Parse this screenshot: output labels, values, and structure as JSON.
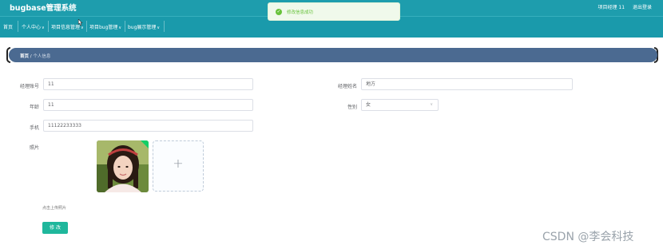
{
  "header": {
    "title": "bugbase管理系统",
    "user_label": "项目经理 11",
    "logout_label": "退出登录"
  },
  "nav": {
    "items": [
      {
        "label": "首页"
      },
      {
        "label": "个人中心"
      },
      {
        "label": "项目信息管理"
      },
      {
        "label": "项目bug管理"
      },
      {
        "label": "bug展示管理"
      }
    ]
  },
  "toast": {
    "message": "修改信息成功"
  },
  "breadcrumb": {
    "home": "首页",
    "separator": "/",
    "current": "个人信息"
  },
  "form": {
    "account": {
      "label": "经理账号",
      "value": "11"
    },
    "name": {
      "label": "经理姓名",
      "value": "地方"
    },
    "age": {
      "label": "年龄",
      "value": "11"
    },
    "gender": {
      "label": "性别",
      "value": "女"
    },
    "phone": {
      "label": "手机",
      "value": "11122233333"
    },
    "photo": {
      "label": "照片",
      "tip": "点击上传照片"
    },
    "save_label": "修 改"
  },
  "watermark": "CSDN @李会科技",
  "colors": {
    "topbar": "#1e9dad",
    "breadcrumb_bar": "#4b6a91",
    "save_button": "#1fb79c",
    "toast_text": "#67c23a"
  }
}
